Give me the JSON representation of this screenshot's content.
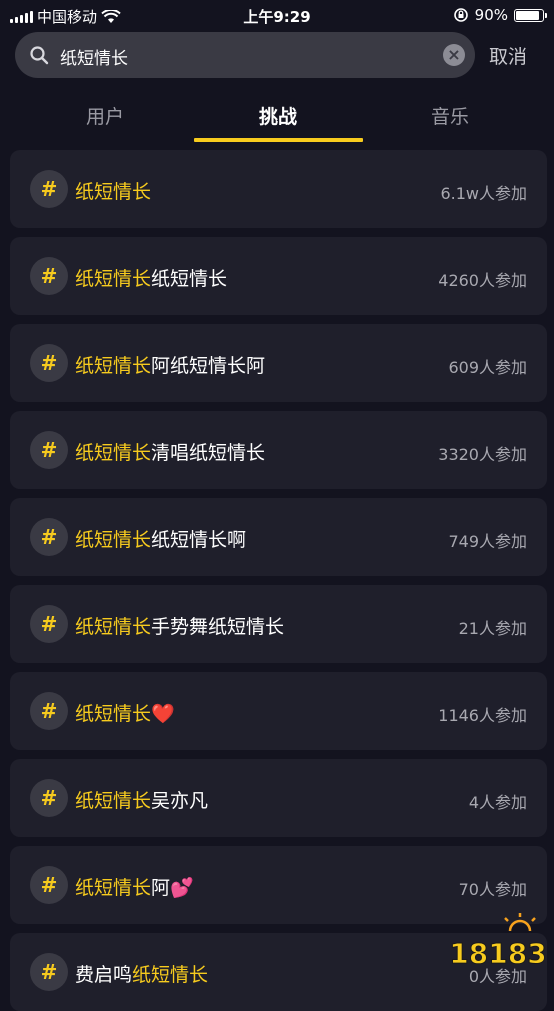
{
  "status_bar": {
    "carrier": "中国移动",
    "time": "上午9:29",
    "battery_text": "90%",
    "battery_level": 0.9
  },
  "search": {
    "query": "纸短情长",
    "cancel_label": "取消"
  },
  "tabs": [
    {
      "label": "用户",
      "active": false
    },
    {
      "label": "挑战",
      "active": true
    },
    {
      "label": "音乐",
      "active": false
    }
  ],
  "results": [
    {
      "pre": "",
      "highlight": "纸短情长",
      "post": "",
      "count": "6.1w人参加"
    },
    {
      "pre": "",
      "highlight": "纸短情长",
      "post": "纸短情长",
      "count": "4260人参加"
    },
    {
      "pre": "",
      "highlight": "纸短情长",
      "post": "阿纸短情长阿",
      "count": "609人参加"
    },
    {
      "pre": "",
      "highlight": "纸短情长",
      "post": "清唱纸短情长",
      "count": "3320人参加"
    },
    {
      "pre": "",
      "highlight": "纸短情长",
      "post": "纸短情长啊",
      "count": "749人参加"
    },
    {
      "pre": "",
      "highlight": "纸短情长",
      "post": "手势舞纸短情长",
      "count": "21人参加"
    },
    {
      "pre": "",
      "highlight": "纸短情长",
      "post": "❤️",
      "count": "1146人参加"
    },
    {
      "pre": "",
      "highlight": "纸短情长",
      "post": "吴亦凡",
      "count": "4人参加"
    },
    {
      "pre": "",
      "highlight": "纸短情长",
      "post": "阿💕",
      "count": "70人参加"
    },
    {
      "pre": "费启鸣",
      "highlight": "纸短情长",
      "post": "",
      "count": "0人参加"
    }
  ],
  "hash_symbol": "#",
  "watermark_text": "18183",
  "colors": {
    "background": "#13131f",
    "row_bg": "#1f1f2b",
    "accent": "#f7cb1e",
    "muted": "#a8a8b0"
  }
}
